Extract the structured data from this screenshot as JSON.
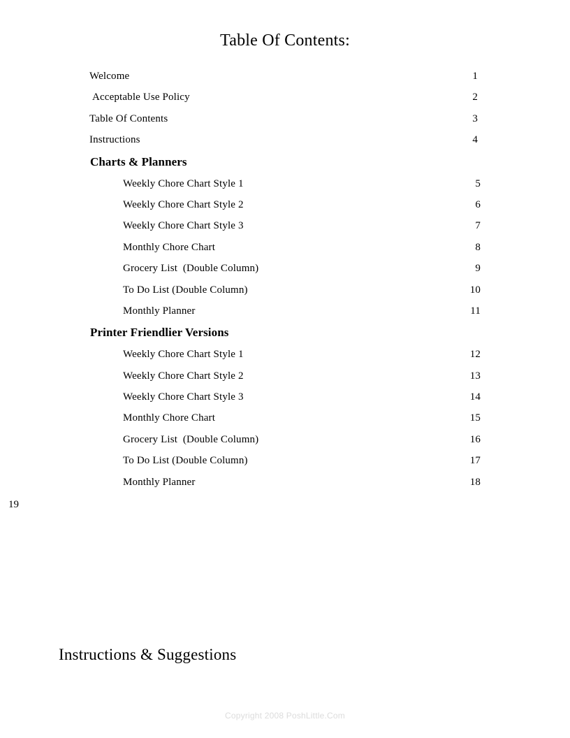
{
  "document": {
    "title": "Table Of Contents:",
    "orphan_page_number": "19",
    "lower_section_title": "Instructions & Suggestions",
    "footer": "Copyright 2008 PoshLittle.Com",
    "footer_color": "#dcdcdc",
    "text_color": "#000000",
    "background_color": "#ffffff"
  },
  "toc": {
    "front_matter": [
      {
        "label": "Welcome",
        "page": "1"
      },
      {
        "label": "Acceptable Use Policy",
        "page": "2"
      },
      {
        "label": "Table Of Contents",
        "page": "3"
      },
      {
        "label": "Instructions",
        "page": "4"
      }
    ],
    "sections": [
      {
        "heading": "Charts & Planners",
        "entries": [
          {
            "label": "Weekly Chore Chart Style 1",
            "page": "5"
          },
          {
            "label": "Weekly Chore Chart Style 2",
            "page": "6"
          },
          {
            "label": "Weekly Chore Chart Style 3",
            "page": "7"
          },
          {
            "label": "Monthly Chore Chart",
            "page": "8"
          },
          {
            "label": "Grocery List  (Double Column)",
            "page": "9"
          },
          {
            "label": "To Do List (Double Column)",
            "page": "10"
          },
          {
            "label": "Monthly Planner",
            "page": "11"
          }
        ]
      },
      {
        "heading": "Printer Friendlier Versions",
        "entries": [
          {
            "label": "Weekly Chore Chart Style 1",
            "page": "12"
          },
          {
            "label": "Weekly Chore Chart Style 2",
            "page": "13"
          },
          {
            "label": "Weekly Chore Chart Style 3",
            "page": "14"
          },
          {
            "label": "Monthly Chore Chart",
            "page": "15"
          },
          {
            "label": "Grocery List  (Double Column)",
            "page": "16"
          },
          {
            "label": "To Do List (Double Column)",
            "page": "17"
          },
          {
            "label": "Monthly Planner",
            "page": "18"
          }
        ]
      }
    ]
  }
}
